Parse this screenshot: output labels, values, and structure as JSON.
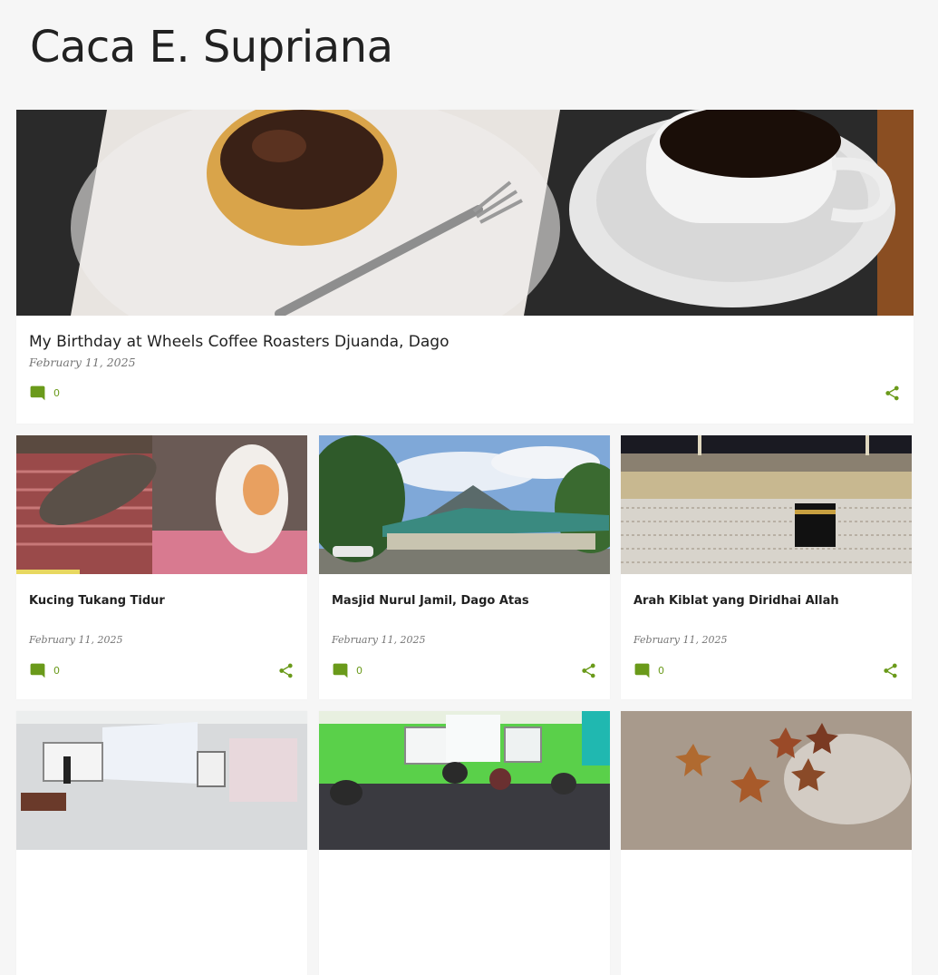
{
  "blog": {
    "title": "Caca E. Supriana"
  },
  "colors": {
    "accent": "#6a9a1a",
    "background": "#f6f6f6",
    "card": "#ffffff"
  },
  "featured": {
    "title": "My Birthday at Wheels Coffee Roasters Djuanda, Dago",
    "date": "February 11, 2025",
    "comments": "0",
    "image": "photo-coffee-and-pastry"
  },
  "posts": [
    {
      "title": "Kucing Tukang Tidur",
      "date": "February 11, 2025",
      "comments": "0",
      "image": "photo-sleeping-cats"
    },
    {
      "title": "Masjid Nurul Jamil, Dago Atas",
      "date": "February 11, 2025",
      "comments": "0",
      "image": "photo-mosque"
    },
    {
      "title": "Arah Kiblat yang Diridhai Allah",
      "date": "February 11, 2025",
      "comments": "0",
      "image": "photo-kaaba"
    },
    {
      "image": "photo-lecture-room"
    },
    {
      "image": "photo-computer-lab"
    },
    {
      "image": "photo-starfish-beach"
    }
  ],
  "icons": {
    "comment": "comment-icon",
    "share": "share-icon"
  }
}
